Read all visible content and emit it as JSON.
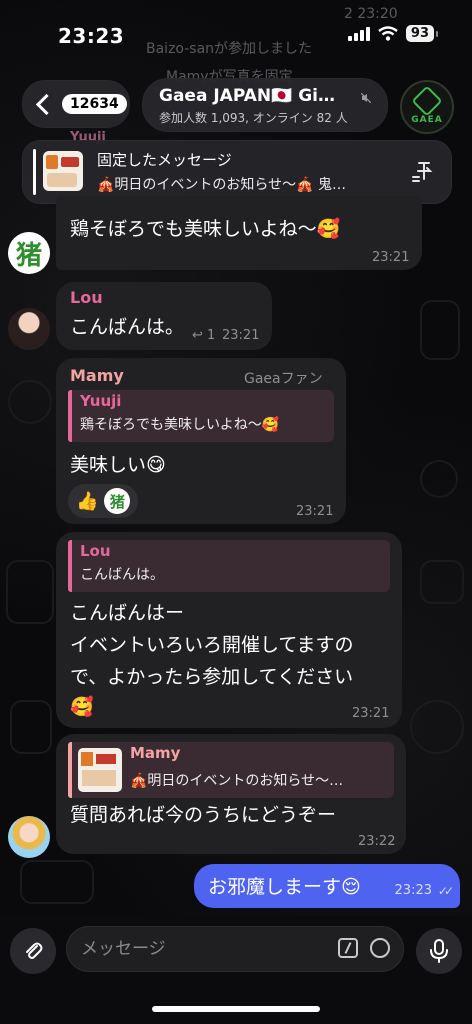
{
  "status": {
    "time": "23:23",
    "battery": "93"
  },
  "behind": {
    "top_time": "2  23:20",
    "system_msg": "Baizo-sanが参加しました",
    "system_msg2": "Mamyが写真を固定",
    "sender_partial": "Yuuji"
  },
  "header": {
    "back_count": "12634",
    "title": "Gaea JAPAN🇯🇵 Gi…",
    "subtitle": "参加人数 1,093, オンライン 82 人",
    "avatar_label": "GAEA"
  },
  "pinned": {
    "title": "固定したメッセージ",
    "text": "🎪明日のイベントのお知らせ～🎪 鬼…"
  },
  "messages": [
    {
      "text": "鶏そぼろでも美味しいよね～🥰",
      "time": "23:21",
      "avatar_text": "猪"
    },
    {
      "sender": "Lou",
      "text": "こんばんは。",
      "replies": "1",
      "time": "23:21"
    },
    {
      "sender": "Mamy",
      "role": "Gaeaファン",
      "quote_name": "Yuuji",
      "quote_text": "鶏そぼろでも美味しいよね～🥰",
      "text": "美味しい😋",
      "time": "23:21",
      "reaction_emoji": "👍",
      "reaction_avatar": "猪"
    },
    {
      "quote_name": "Lou",
      "quote_text": "こんばんは。",
      "line1": "こんばんはー",
      "line2": "イベントいろいろ開催してますの",
      "line3": "で、よかったら参加してください",
      "line4": "🥰",
      "time": "23:21"
    },
    {
      "quote_name": "Mamy",
      "quote_text": "🎪明日のイベントのお知らせ～…",
      "text": "質問あれば今のうちにどうぞー",
      "time": "23:22"
    }
  ],
  "outgoing": {
    "text": "お邪魔しまーす😌",
    "time": "23:23",
    "ticks": "✓✓"
  },
  "input": {
    "placeholder": "メッセージ"
  },
  "colors": {
    "accent": "#4e63f0",
    "lou": "#e4689a",
    "mamy": "#f4a3a3",
    "yuuji": "#e4689a",
    "green": "#3fb950"
  }
}
